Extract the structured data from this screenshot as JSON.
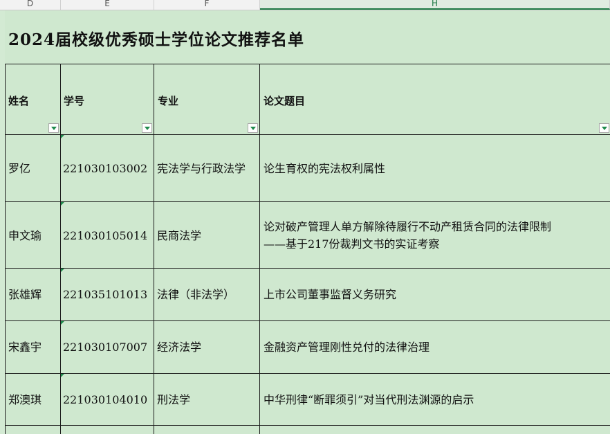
{
  "columns": [
    {
      "letter": "D",
      "active": false
    },
    {
      "letter": "E",
      "active": false
    },
    {
      "letter": "F",
      "active": false
    },
    {
      "letter": "H",
      "active": true
    }
  ],
  "title": "2024届校级优秀硕士学位论文推荐名单",
  "headers": {
    "name": "姓名",
    "id": "学号",
    "major": "专业",
    "thesis": "论文题目"
  },
  "rows": [
    {
      "name": "罗亿",
      "id": "221030103002",
      "major": "宪法学与行政法学",
      "thesis": [
        "论生育权的宪法权利属性"
      ]
    },
    {
      "name": "申文瑜",
      "id": "221030105014",
      "major": "民商法学",
      "thesis": [
        "论对破产管理人单方解除待履行不动产租赁合同的法律限制",
        "——基于217份裁判文书的实证考察"
      ]
    },
    {
      "name": "张雄辉",
      "id": "221035101013",
      "major": "法律（非法学）",
      "thesis": [
        "上市公司董事监督义务研究"
      ]
    },
    {
      "name": "宋鑫宇",
      "id": "221030107007",
      "major": "经济法学",
      "thesis": [
        "金融资产管理刚性兑付的法律治理"
      ]
    },
    {
      "name": "郑澳琪",
      "id": "221030104010",
      "major": "刑法学",
      "thesis": [
        "中华刑律“断罪须引”对当代刑法渊源的启示"
      ]
    }
  ]
}
